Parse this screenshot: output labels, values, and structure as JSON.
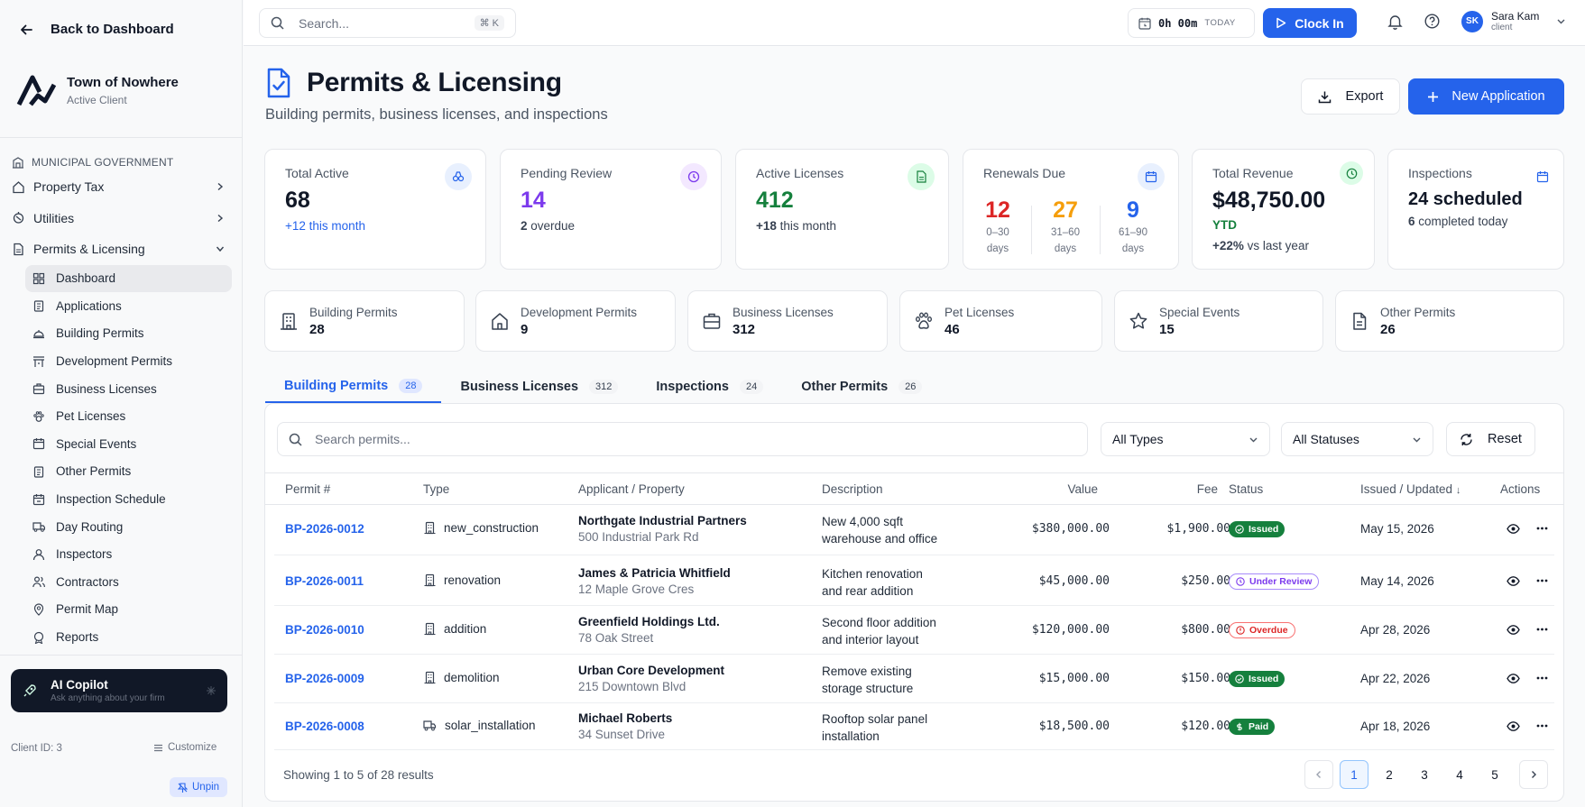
{
  "sidebar": {
    "back_label": "Back to Dashboard",
    "client_name": "Town of Nowhere",
    "client_status": "Active Client",
    "group_label": "MUNICIPAL GOVERNMENT",
    "top_items": [
      {
        "label": "Property Tax",
        "icon": "home-icon"
      },
      {
        "label": "Utilities",
        "icon": "utilities-icon"
      },
      {
        "label": "Permits & Licensing",
        "icon": "file-icon"
      }
    ],
    "sub_items": [
      {
        "label": "Dashboard",
        "icon": "grid-icon"
      },
      {
        "label": "Applications",
        "icon": "clipboard-icon"
      },
      {
        "label": "Building Permits",
        "icon": "hardhat-icon"
      },
      {
        "label": "Development Permits",
        "icon": "development-icon"
      },
      {
        "label": "Business Licenses",
        "icon": "briefcase-icon"
      },
      {
        "label": "Pet Licenses",
        "icon": "paw-icon"
      },
      {
        "label": "Special Events",
        "icon": "calendar-icon"
      },
      {
        "label": "Other Permits",
        "icon": "clipboard-icon"
      },
      {
        "label": "Inspection Schedule",
        "icon": "calendar-check-icon"
      },
      {
        "label": "Day Routing",
        "icon": "truck-icon"
      },
      {
        "label": "Inspectors",
        "icon": "user-icon"
      },
      {
        "label": "Contractors",
        "icon": "users-icon"
      },
      {
        "label": "Permit Map",
        "icon": "map-pin-icon"
      },
      {
        "label": "Reports",
        "icon": "award-icon"
      }
    ],
    "copilot_title": "AI Copilot",
    "copilot_sub": "Ask anything about your firm",
    "client_id": "Client ID: 3",
    "customize": "Customize",
    "unpin": "Unpin"
  },
  "topbar": {
    "search_placeholder": "Search...",
    "shortcut": "⌘ K",
    "timer": "0h 00m",
    "timer_label": "TODAY",
    "clock_in": "Clock In",
    "user_initials": "SK",
    "user_name": "Sara Kam",
    "user_role": "client"
  },
  "header": {
    "title": "Permits & Licensing",
    "subtitle": "Building permits, business licenses, and inspections",
    "export_label": "Export",
    "new_label": "New Application"
  },
  "stats": {
    "total_active": {
      "label": "Total Active",
      "value": "68",
      "delta": "+12",
      "delta_text": "this month"
    },
    "pending": {
      "label": "Pending Review",
      "value": "14",
      "count": "2",
      "text": "overdue"
    },
    "licenses": {
      "label": "Active Licenses",
      "value": "412",
      "delta": "+18",
      "delta_text": "this month"
    },
    "renewals": {
      "label": "Renewals Due",
      "items": [
        {
          "value": "12",
          "range": "0–30",
          "unit": "days"
        },
        {
          "value": "27",
          "range": "31–60",
          "unit": "days"
        },
        {
          "value": "9",
          "range": "61–90",
          "unit": "days"
        }
      ]
    },
    "revenue": {
      "label": "Total Revenue",
      "value": "$48,750.00",
      "period": "YTD",
      "delta": "+22%",
      "delta_text": "vs last year"
    },
    "inspections": {
      "label": "Inspections",
      "value": "24 scheduled",
      "count": "6",
      "text": "completed today"
    }
  },
  "categories": [
    {
      "name": "Building Permits",
      "value": "28",
      "icon": "building-icon"
    },
    {
      "name": "Development Permits",
      "value": "9",
      "icon": "house-icon"
    },
    {
      "name": "Business Licenses",
      "value": "312",
      "icon": "briefcase-icon"
    },
    {
      "name": "Pet Licenses",
      "value": "46",
      "icon": "paw-icon"
    },
    {
      "name": "Special Events",
      "value": "15",
      "icon": "star-icon"
    },
    {
      "name": "Other Permits",
      "value": "26",
      "icon": "document-icon"
    }
  ],
  "tabs": [
    {
      "label": "Building Permits",
      "count": "28"
    },
    {
      "label": "Business Licenses",
      "count": "312"
    },
    {
      "label": "Inspections",
      "count": "24"
    },
    {
      "label": "Other Permits",
      "count": "26"
    }
  ],
  "filters": {
    "search_placeholder": "Search permits...",
    "type_value": "All Types",
    "status_value": "All Statuses",
    "reset_label": "Reset"
  },
  "table": {
    "columns": [
      "Permit #",
      "Type",
      "Applicant / Property",
      "Description",
      "Value",
      "Fee",
      "Status",
      "Issued / Updated",
      "Actions"
    ],
    "sort_indicator": "↓",
    "rows": [
      {
        "permit": "BP-2026-0012",
        "type": "new_construction",
        "applicant": "Northgate Industrial Partners",
        "property": "500 Industrial Park Rd",
        "desc1": "New 4,000 sqft",
        "desc2": "warehouse and office",
        "value": "$380,000.00",
        "fee": "$1,900.00",
        "status": "Issued",
        "status_kind": "issued",
        "date": "May 15, 2026"
      },
      {
        "permit": "BP-2026-0011",
        "type": "renovation",
        "applicant": "James & Patricia Whitfield",
        "property": "12 Maple Grove Cres",
        "desc1": "Kitchen renovation",
        "desc2": "and rear addition",
        "value": "$45,000.00",
        "fee": "$250.00",
        "status": "Under Review",
        "status_kind": "review",
        "date": "May 14, 2026"
      },
      {
        "permit": "BP-2026-0010",
        "type": "addition",
        "applicant": "Greenfield Holdings Ltd.",
        "property": "78 Oak Street",
        "desc1": "Second floor addition",
        "desc2": "and interior layout",
        "value": "$120,000.00",
        "fee": "$800.00",
        "status": "Overdue",
        "status_kind": "overdue",
        "date": "Apr 28, 2026"
      },
      {
        "permit": "BP-2026-0009",
        "type": "demolition",
        "applicant": "Urban Core Development",
        "property": "215 Downtown Blvd",
        "desc1": "Remove existing",
        "desc2": "storage structure",
        "value": "$15,000.00",
        "fee": "$150.00",
        "status": "Issued",
        "status_kind": "issued",
        "date": "Apr 22, 2026"
      },
      {
        "permit": "BP-2026-0008",
        "type": "solar_installation",
        "applicant": "Michael Roberts",
        "property": "34 Sunset Drive",
        "desc1": "Rooftop solar panel",
        "desc2": "installation",
        "value": "$18,500.00",
        "fee": "$120.00",
        "status": "Paid",
        "status_kind": "paid",
        "date": "Apr 18, 2026"
      }
    ],
    "footer": "Showing 1 to 5 of 28 results",
    "pages": [
      "1",
      "2",
      "3",
      "4",
      "5"
    ]
  }
}
